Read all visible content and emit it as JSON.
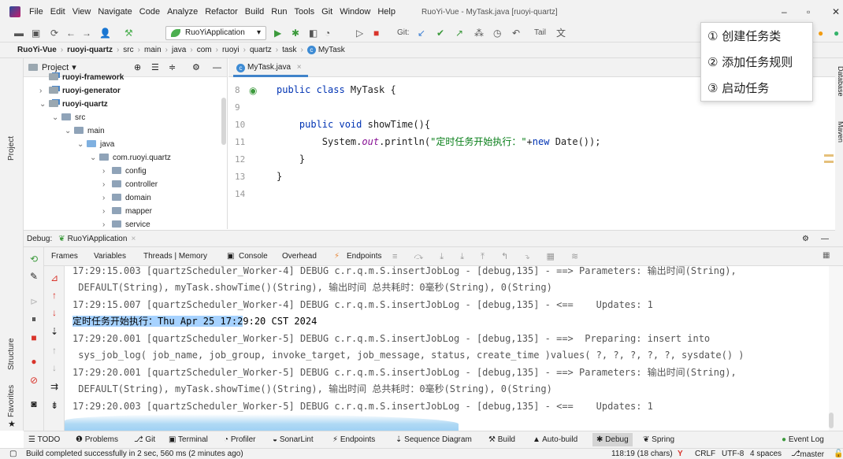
{
  "menubar": {
    "items": [
      "File",
      "Edit",
      "View",
      "Navigate",
      "Code",
      "Analyze",
      "Refactor",
      "Build",
      "Run",
      "Tools",
      "Git",
      "Window",
      "Help"
    ],
    "window_title": "RuoYi-Vue - MyTask.java [ruoyi-quartz]",
    "minimize": "–",
    "restore": "▫",
    "close": "✕"
  },
  "toolbar": {
    "run_config": "RuoYiApplication",
    "git_label": "Git:",
    "tail_label": "Tail"
  },
  "breadcrumb": [
    "RuoYi-Vue",
    "ruoyi-quartz",
    "src",
    "main",
    "java",
    "com",
    "ruoyi",
    "quartz",
    "task",
    "MyTask"
  ],
  "left_stripe": {
    "project": "Project",
    "structure": "Structure",
    "favorites": "Favorites"
  },
  "right_stripe": {
    "database": "Database",
    "maven": "Maven"
  },
  "project_panel": {
    "title": "Project",
    "items": [
      {
        "label": "ruoyi-framework"
      },
      {
        "label": "ruoyi-generator"
      },
      {
        "label": "ruoyi-quartz"
      },
      {
        "label": "src"
      },
      {
        "label": "main"
      },
      {
        "label": "java"
      },
      {
        "label": "com.ruoyi.quartz"
      },
      {
        "label": "config"
      },
      {
        "label": "controller"
      },
      {
        "label": "domain"
      },
      {
        "label": "mapper"
      },
      {
        "label": "service"
      }
    ]
  },
  "editor": {
    "tab_label": "MyTask.java",
    "line_numbers": [
      "8",
      "9",
      "10",
      "11",
      "12",
      "13",
      "14"
    ],
    "lines": {
      "l8_kw": "public class ",
      "l8_name": "MyTask {",
      "l10_kw": "    public void ",
      "l10_name": "showTime(){",
      "l11_a": "        System.",
      "l11_out": "out",
      "l11_b": ".println(",
      "l11_str": "\"定时任务开始执行：\"",
      "l11_c": "+",
      "l11_new": "new ",
      "l11_d": "Date());",
      "l12": "    }",
      "l13": "}"
    }
  },
  "popup": {
    "items": [
      "① 创建任务类",
      "② 添加任务规则",
      "③ 启动任务"
    ]
  },
  "debug": {
    "title": "Debug:",
    "session": "RuoYiApplication",
    "tabs": [
      "Frames",
      "Variables",
      "Threads | Memory",
      "Console",
      "Overhead",
      "Endpoints"
    ],
    "console_lines": [
      "17:29:15.003 [quartzScheduler_Worker-4] DEBUG c.r.q.m.S.insertJobLog - [debug,135] - ==> Parameters: 输出时间(String),",
      " DEFAULT(String), myTask.showTime()(String), 输出时间 总共耗时：0毫秒(String), 0(String)",
      "17:29:15.007 [quartzScheduler_Worker-4] DEBUG c.r.q.m.S.insertJobLog - [debug,135] - <==    Updates: 1",
      "17:29:20.001 [quartzScheduler_Worker-5] DEBUG c.r.q.m.S.insertJobLog - [debug,135] - ==>  Preparing: insert into",
      " sys_job_log( job_name, job_group, invoke_target, job_message, status, create_time )values( ?, ?, ?, ?, ?, sysdate() )",
      "17:29:20.001 [quartzScheduler_Worker-5] DEBUG c.r.q.m.S.insertJobLog - [debug,135] - ==> Parameters: 输出时间(String),",
      " DEFAULT(String), myTask.showTime()(String), 输出时间 总共耗时：0毫秒(String), 0(String)",
      "17:29:20.003 [quartzScheduler_Worker-5] DEBUG c.r.q.m.S.insertJobLog - [debug,135] - <==    Updates: 1"
    ],
    "highlight_line_selected": "定时任务开始执行：Thu Apr 25 17:2",
    "highlight_line_rest": "9:20 CST 2024"
  },
  "tool_tabs": [
    "TODO",
    "Problems",
    "Git",
    "Terminal",
    "Profiler",
    "SonarLint",
    "Endpoints",
    "Sequence Diagram",
    "Build",
    "Auto-build",
    "Debug",
    "Spring",
    "Event Log"
  ],
  "statusbar": {
    "message": "Build completed successfully in 2 sec, 560 ms (2 minutes ago)",
    "position": "118:19 (18 chars)",
    "line_sep": "CRLF",
    "encoding": "UTF-8",
    "indent": "4 spaces",
    "branch": "master"
  }
}
